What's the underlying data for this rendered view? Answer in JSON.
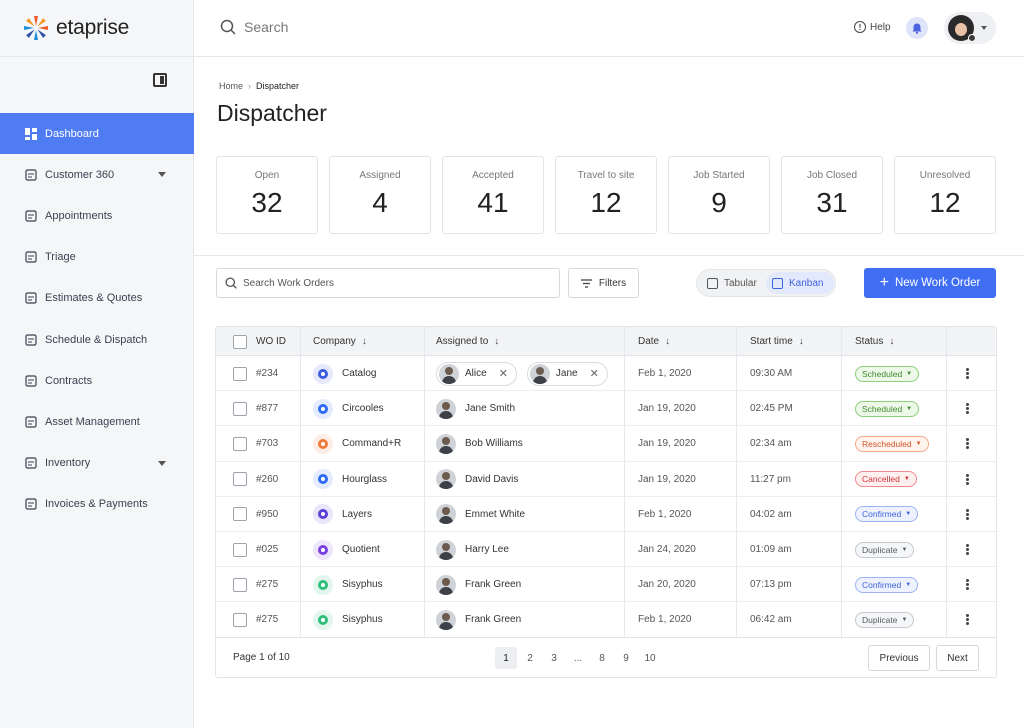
{
  "brand": {
    "name": "etaprise"
  },
  "colors": {
    "accent": "#4f7cf2",
    "primary_button": "#3f6ef3"
  },
  "sidebar": {
    "items": [
      {
        "label": "Dashboard",
        "icon": "dashboard-icon",
        "active": true
      },
      {
        "label": "Customer 360",
        "icon": "customer-icon",
        "has_caret": true
      },
      {
        "label": "Appointments",
        "icon": "calendar-icon"
      },
      {
        "label": "Triage",
        "icon": "triage-icon"
      },
      {
        "label": "Estimates & Quotes",
        "icon": "estimate-icon"
      },
      {
        "label": "Schedule & Dispatch",
        "icon": "schedule-icon"
      },
      {
        "label": "Contracts",
        "icon": "contract-icon"
      },
      {
        "label": "Asset Management",
        "icon": "asset-icon"
      },
      {
        "label": "Inventory",
        "icon": "inventory-icon",
        "has_caret": true
      },
      {
        "label": "Invoices & Payments",
        "icon": "invoice-icon"
      }
    ]
  },
  "topbar": {
    "search_placeholder": "Search",
    "help_label": "Help"
  },
  "breadcrumb": {
    "home": "Home",
    "current": "Dispatcher"
  },
  "page_title": "Dispatcher",
  "stats": [
    {
      "label": "Open",
      "value": "32"
    },
    {
      "label": "Assigned",
      "value": "4"
    },
    {
      "label": "Accepted",
      "value": "41"
    },
    {
      "label": "Travel to site",
      "value": "12"
    },
    {
      "label": "Job Started",
      "value": "9"
    },
    {
      "label": "Job Closed",
      "value": "31"
    },
    {
      "label": "Unresolved",
      "value": "12"
    }
  ],
  "toolbar": {
    "search_placeholder": "Search Work Orders",
    "filters_label": "Filters",
    "view_tabular": "Tabular",
    "view_kanban": "Kanban",
    "new_button": "New Work Order"
  },
  "table": {
    "headers": {
      "wo_id": "WO ID",
      "company": "Company",
      "assigned": "Assigned to",
      "date": "Date",
      "start": "Start time",
      "status": "Status"
    },
    "rows": [
      {
        "id": "#234",
        "company": "Catalog",
        "logo_color": "#3d5be0",
        "assigned": [
          "Alice",
          "Jane"
        ],
        "date": "Feb 1, 2020",
        "time": "09:30 AM",
        "status": "Scheduled"
      },
      {
        "id": "#877",
        "company": "Circooles",
        "logo_color": "#2f6bf0",
        "assigned": [
          "Jane Smith"
        ],
        "date": "Jan 19, 2020",
        "time": "02:45 PM",
        "status": "Scheduled"
      },
      {
        "id": "#703",
        "company": "Command+R",
        "logo_color": "#f07a3a",
        "assigned": [
          "Bob Williams"
        ],
        "date": "Jan 19, 2020",
        "time": "02:34 am",
        "status": "Rescheduled"
      },
      {
        "id": "#260",
        "company": "Hourglass",
        "logo_color": "#2f6bf0",
        "assigned": [
          "David Davis"
        ],
        "date": "Jan 19, 2020",
        "time": "11:27 pm",
        "status": "Cancelled"
      },
      {
        "id": "#950",
        "company": "Layers",
        "logo_color": "#5b3fd6",
        "assigned": [
          "Emmet White"
        ],
        "date": "Feb 1, 2020",
        "time": "04:02 am",
        "status": "Confirmed"
      },
      {
        "id": "#025",
        "company": "Quotient",
        "logo_color": "#7a3fe0",
        "assigned": [
          "Harry Lee"
        ],
        "date": "Jan 24, 2020",
        "time": "01:09 am",
        "status": "Duplicate"
      },
      {
        "id": "#275",
        "company": "Sisyphus",
        "logo_color": "#2fbf7a",
        "assigned": [
          "Frank Green"
        ],
        "date": "Jan 20, 2020",
        "time": "07:13 pm",
        "status": "Confirmed"
      },
      {
        "id": "#275",
        "company": "Sisyphus",
        "logo_color": "#2fbf7a",
        "assigned": [
          "Frank Green"
        ],
        "date": "Feb 1, 2020",
        "time": "06:42 am",
        "status": "Duplicate"
      }
    ],
    "status_colors": {
      "Scheduled": {
        "fg": "#3d8a2e",
        "bg": "#eef8e9",
        "border": "#8ccf7a"
      },
      "Rescheduled": {
        "fg": "#d0552b",
        "bg": "#fff3ee",
        "border": "#f0a888"
      },
      "Cancelled": {
        "fg": "#d0343b",
        "bg": "#fff0f0",
        "border": "#ec8a8e"
      },
      "Confirmed": {
        "fg": "#3f63d8",
        "bg": "#eef2ff",
        "border": "#9cb2f3"
      },
      "Duplicate": {
        "fg": "#555a63",
        "bg": "#f5f6f7",
        "border": "#c5c9cf"
      }
    }
  },
  "pagination": {
    "info": "Page 1 of 10",
    "pages": [
      "1",
      "2",
      "3",
      "...",
      "8",
      "9",
      "10"
    ],
    "current": "1",
    "prev_label": "Previous",
    "next_label": "Next"
  }
}
